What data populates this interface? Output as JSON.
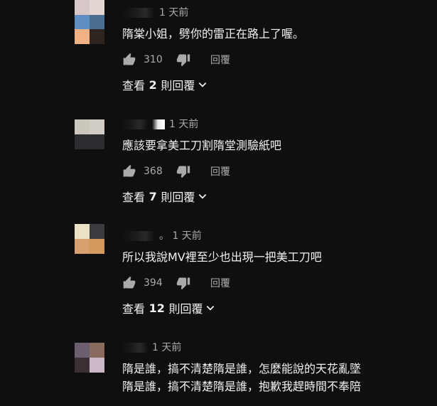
{
  "comments": [
    {
      "time": "1 天前",
      "text": "隋棠小姐，劈你的雷正在路上了喔。",
      "likes": "310",
      "reply_label": "回覆",
      "view_replies": {
        "prefix": "查看",
        "count": "2",
        "suffix": "則回覆"
      },
      "avatar_colors": [
        "#d7c7c6",
        "#e3d6d3",
        "#5f8fc2",
        "#4b6e8e",
        "#f0b184",
        "#2f2520"
      ]
    },
    {
      "time": "1 天前",
      "text": "應該要拿美工刀割隋堂測驗紙吧",
      "likes": "368",
      "reply_label": "回覆",
      "view_replies": {
        "prefix": "查看",
        "count": "7",
        "suffix": "則回覆"
      },
      "avatar_colors": [
        "#cbc7bd",
        "#d1cdc4",
        "#2b2d31",
        "#2b2d31"
      ]
    },
    {
      "time_prefix": "。",
      "time": "1 天前",
      "text": "所以我說MV裡至少也出現一把美工刀吧",
      "likes": "394",
      "reply_label": "回覆",
      "view_replies": {
        "prefix": "查看",
        "count": "12",
        "suffix": "則回覆"
      },
      "avatar_colors": [
        "#ebe2c5",
        "#3a3b3e",
        "#d6a071",
        "#d39a5c"
      ]
    },
    {
      "time": "1 天前",
      "lines": [
        "隋是誰，搞不清楚隋是誰，怎麼能說的天花亂墜",
        "隋是誰，搞不清楚隋是誰，抱歉我趕時間不奉陪"
      ],
      "avatar_colors": [
        "#6c6070",
        "#8a6c5f",
        "#3a2f33",
        "#cbb8c8"
      ]
    }
  ],
  "icons": {
    "like": "thumb-up-icon",
    "dislike": "thumb-down-icon",
    "expand": "chevron-down-icon"
  }
}
